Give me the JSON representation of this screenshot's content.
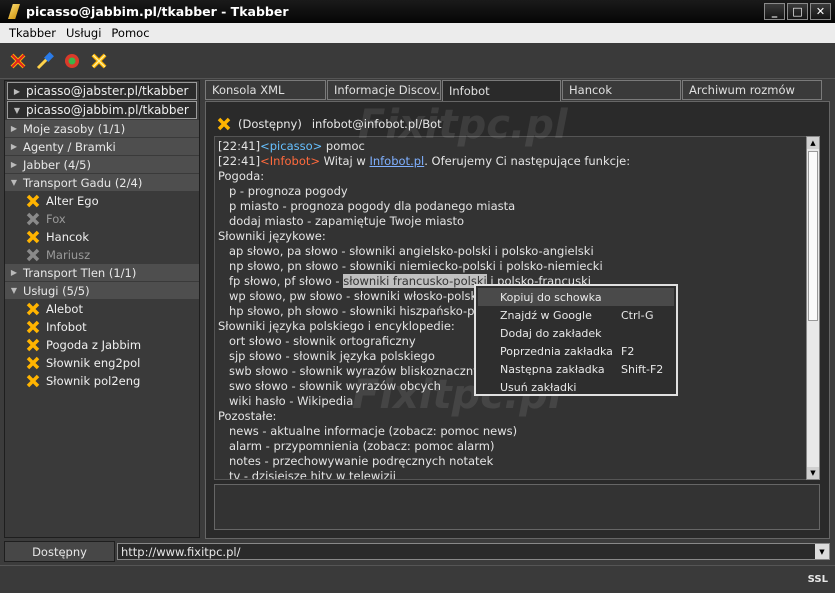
{
  "window": {
    "title": "picasso@jabbim.pl/tkabber - Tkabber",
    "buttons": [
      "_",
      "□",
      "✕"
    ]
  },
  "menu": [
    "Tkabber",
    "Usługi",
    "Pomoc"
  ],
  "toolbar": {
    "icons": [
      "disconnect-icon",
      "connect-icon",
      "settings-icon",
      "status-icon"
    ]
  },
  "roster": {
    "accounts": [
      "picasso@jabster.pl/tkabber",
      "picasso@jabbim.pl/tkabber"
    ],
    "groups": [
      {
        "label": "Moje zasoby (1/1)",
        "expanded": false,
        "contacts": []
      },
      {
        "label": "Agenty / Bramki",
        "expanded": false,
        "contacts": []
      },
      {
        "label": "Jabber (4/5)",
        "expanded": false,
        "contacts": []
      },
      {
        "label": "Transport Gadu (2/4)",
        "expanded": true,
        "contacts": [
          {
            "name": "Alter Ego",
            "online": true
          },
          {
            "name": "Fox",
            "online": false
          },
          {
            "name": "Hancok",
            "online": true
          },
          {
            "name": "Mariusz",
            "online": false
          }
        ]
      },
      {
        "label": "Transport Tlen (1/1)",
        "expanded": false,
        "contacts": []
      },
      {
        "label": "Usługi (5/5)",
        "expanded": true,
        "contacts": [
          {
            "name": "Alebot",
            "online": true
          },
          {
            "name": "Infobot",
            "online": true
          },
          {
            "name": "Pogoda z Jabbim",
            "online": true
          },
          {
            "name": "Słownik eng2pol",
            "online": true
          },
          {
            "name": "Słownik pol2eng",
            "online": true
          }
        ]
      }
    ]
  },
  "tabs": [
    {
      "label": "Konsola XML",
      "active": false
    },
    {
      "label": "Informacje Discov...",
      "active": false
    },
    {
      "label": "Infobot",
      "active": true
    },
    {
      "label": "Hancok",
      "active": false
    },
    {
      "label": "Archiwum rozmów",
      "active": false
    }
  ],
  "chat": {
    "status": "(Dostępny)",
    "jid": "infobot@infobot.pl/Bot",
    "msg1": {
      "time": "[22:41]",
      "nick": "<picasso>",
      "text": " pomoc"
    },
    "msg2": {
      "time": "[22:41]",
      "nick": "<Infobot>",
      "pre": " Witaj w ",
      "link": "Infobot.pl",
      "post": ". Oferujemy Ci następujące funkcje:"
    },
    "lines": [
      "Pogoda:",
      "   p - prognoza pogody",
      "   p miasto - prognoza pogody dla podanego miasta",
      "   dodaj miasto - zapamiętuje Twoje miasto",
      "Słowniki językowe:",
      "   ap słowo, pa słowo - słowniki angielsko-polski i polsko-angielski",
      "   np słowo, pn słowo - słowniki niemiecko-polski i polsko-niemiecki"
    ],
    "hline": {
      "pre": "   fp słowo, pf słowo - ",
      "hl": "słowniki francusko-polski",
      "post": " i polsko-francuski"
    },
    "lines2": [
      "   wp słowo, pw słowo - słowniki włosko-polski i polsko-włoski",
      "   hp słowo, ph słowo - słowniki hiszpańsko-polski i polsko-hiszpański",
      "Słowniki języka polskiego i encyklopedie:",
      "   ort słowo - słownik ortograficzny",
      "   sjp słowo - słownik języka polskiego",
      "   swb słowo - słownik wyrazów bliskoznacznych",
      "   swo słowo - słownik wyrazów obcych",
      "   wiki hasło - Wikipedia",
      "Pozostałe:",
      "   news - aktualne informacje (zobacz: pomoc news)",
      "   alarm - przypomnienia (zobacz: pomoc alarm)",
      "   notes - przechowywanie podręcznych notatek",
      "   tv - dzisiejsze hity w telewizji"
    ]
  },
  "context_menu": [
    {
      "label": "Kopiuj do schowka",
      "shortcut": ""
    },
    {
      "label": "Znajdź w Google",
      "shortcut": "Ctrl-G"
    },
    {
      "label": "Dodaj do zakładek",
      "shortcut": ""
    },
    {
      "label": "Poprzednia zakładka",
      "shortcut": "F2"
    },
    {
      "label": "Następna zakładka",
      "shortcut": "Shift-F2"
    },
    {
      "label": "Usuń zakładki",
      "shortcut": ""
    }
  ],
  "status": {
    "state": "Dostępny",
    "url": "http://www.fixitpc.pl/",
    "ssl": "SSL"
  },
  "watermark": "Fixitpc.pl",
  "colors": {
    "accent_nick_self": "#66c0ff",
    "accent_nick_bot": "#ff6a3d",
    "status_online": "#ffb400"
  }
}
